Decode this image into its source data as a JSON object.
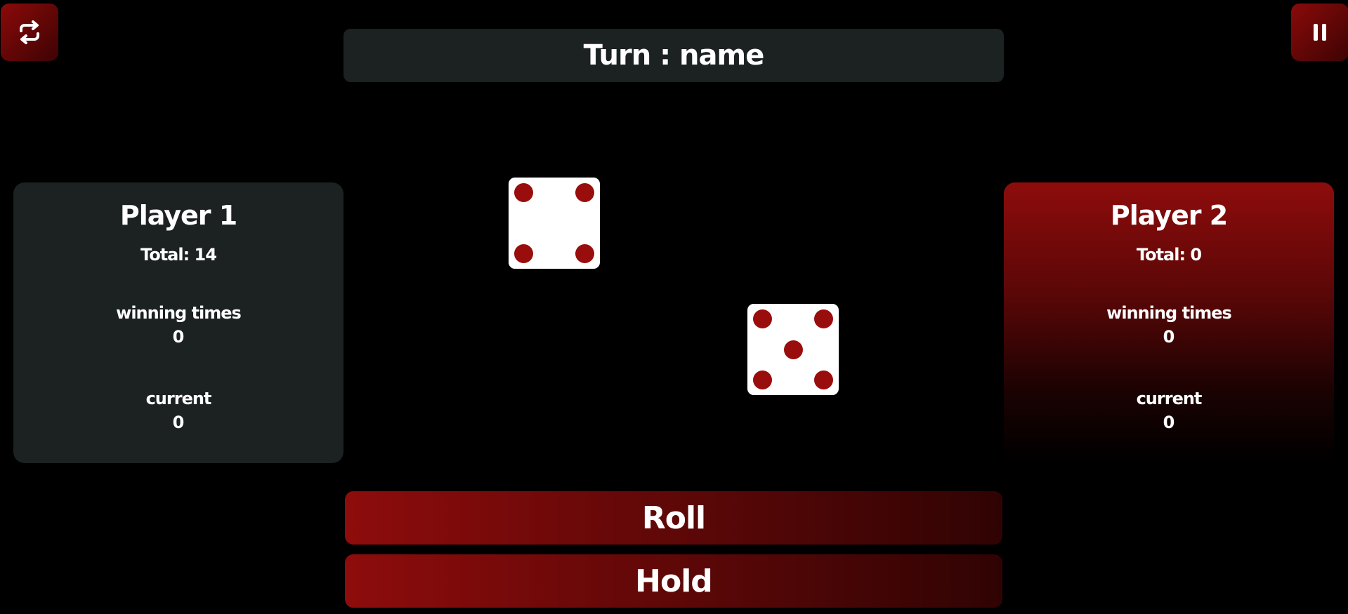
{
  "header": {
    "turn_text": "Turn : name"
  },
  "controls": {
    "restart_icon": "repeat-arrows-icon",
    "pause_icon": "pause-icon"
  },
  "players": [
    {
      "name": "Player 1",
      "total": "Total: 14",
      "winning_label": "winning times",
      "winning_value": "0",
      "current_label": "current",
      "current_value": "0"
    },
    {
      "name": "Player 2",
      "total": "Total: 0",
      "winning_label": "winning times",
      "winning_value": "0",
      "current_label": "current",
      "current_value": "0"
    }
  ],
  "dice": [
    {
      "value": 4
    },
    {
      "value": 5
    }
  ],
  "actions": {
    "roll_label": "Roll",
    "hold_label": "Hold"
  },
  "colors": {
    "accent": "#8e0c0c",
    "panel": "#1c2122",
    "pip": "#9a0d0d",
    "background": "#000000"
  }
}
